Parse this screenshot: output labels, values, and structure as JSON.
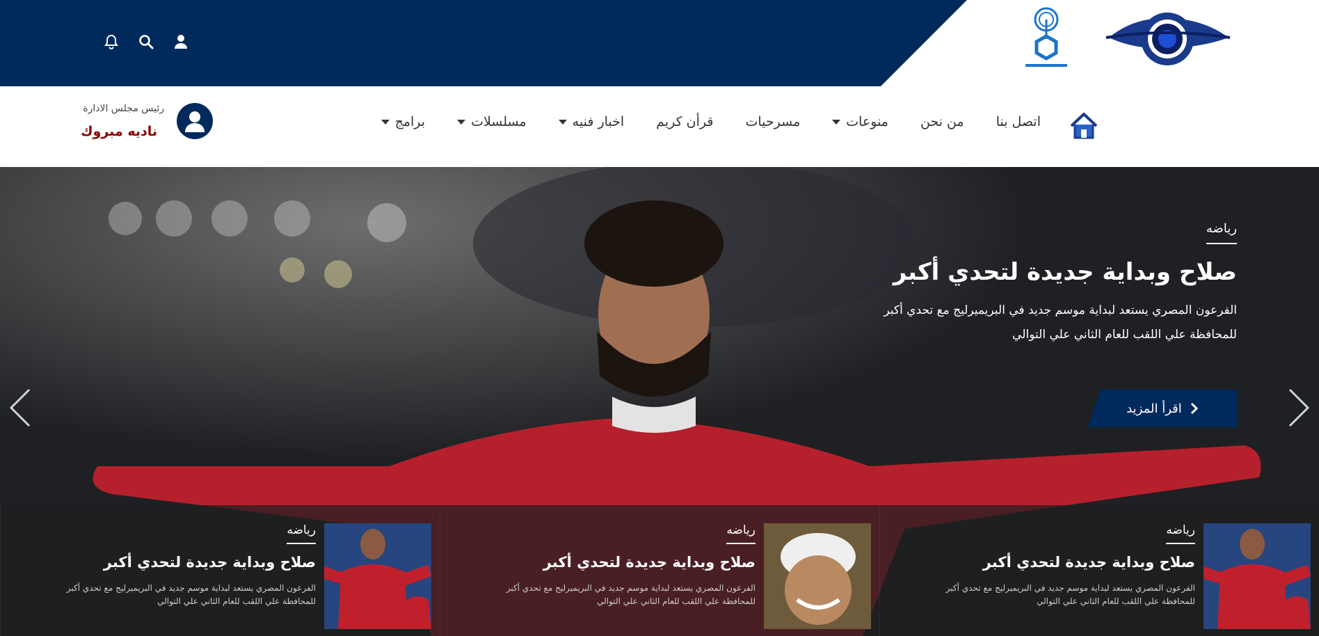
{
  "colors": {
    "brand_navy": "#002a5c",
    "chair_name": "#8b0000"
  },
  "top_icons": [
    "user-icon",
    "search-icon",
    "bell-icon"
  ],
  "nav": {
    "home_icon": "home-icon",
    "items": [
      {
        "label": "برامج",
        "dropdown": true
      },
      {
        "label": "مسلسلات",
        "dropdown": true
      },
      {
        "label": "اخبار فنيه",
        "dropdown": true
      },
      {
        "label": "قرأن كريم",
        "dropdown": false
      },
      {
        "label": "مسرحيات",
        "dropdown": false
      },
      {
        "label": "منوعات",
        "dropdown": true
      },
      {
        "label": "من نحن",
        "dropdown": false
      },
      {
        "label": "اتصل بنا",
        "dropdown": false
      }
    ]
  },
  "chairman": {
    "role": "رئيس مجلس الادارة",
    "name": "ناديه مبروك"
  },
  "hero": {
    "category": "رياضه",
    "title": "صلاح وبداية جديدة لتحدي أكبر",
    "desc_line1": "الفرعون المصري يستعد لبداية موسم جديد في البريميرليج مع تحدي أكبر",
    "desc_line2": "للمحافظة علي اللقب للعام الثاني علي التوالي",
    "button": "اقرأ المزيد"
  },
  "thumbs": [
    {
      "category": "رياضه",
      "title": "صلاح وبداية جديدة لتحدي أكبر",
      "desc_line1": "الفرعون المصري يستعد لبداية موسم جديد في البريميرليج مع تحدي أكبر",
      "desc_line2": "للمحافظة علي اللقب للعام الثاني علي التوالي"
    },
    {
      "category": "رياضه",
      "title": "صلاح وبداية جديدة لتحدي أكبر",
      "desc_line1": "الفرعون المصري يستعد لبداية موسم جديد في البريميرليج مع تحدي أكبر",
      "desc_line2": "للمحافظة علي اللقب للعام الثاني علي التوالي"
    },
    {
      "category": "رياضه",
      "title": "صلاح وبداية جديدة لتحدي أكبر",
      "desc_line1": "الفرعون المصري يستعد لبداية موسم جديد في البريميرليج مع تحدي أكبر",
      "desc_line2": "للمحافظة علي اللقب للعام الثاني علي التوالي"
    }
  ]
}
